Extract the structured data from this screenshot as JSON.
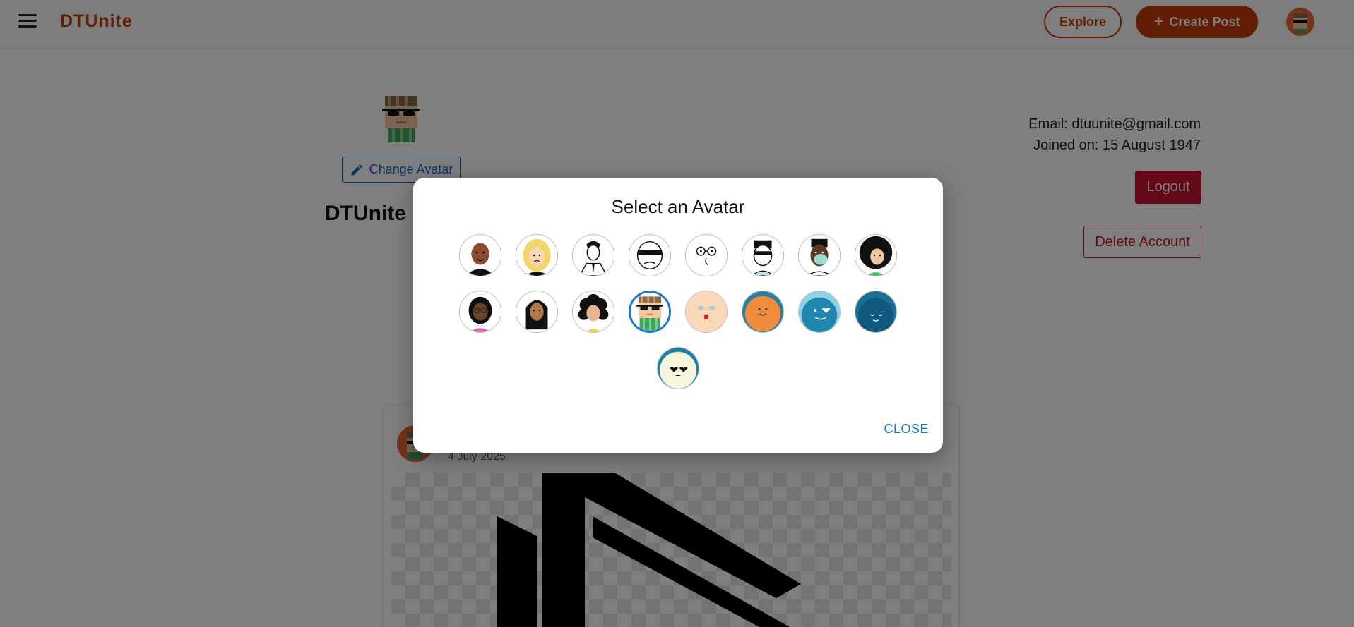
{
  "header": {
    "brand": "DTUnite",
    "explore_label": "Explore",
    "create_post_label": "Create Post",
    "menu_icon": "hamburger-menu-icon",
    "create_icon": "plus-icon"
  },
  "profile": {
    "change_avatar_label": "Change Avatar",
    "change_avatar_icon": "pencil-icon",
    "username": "DTUnite",
    "email_text": "Email: dtuunite@gmail.com",
    "joined_text": "Joined on: 15 August 1947",
    "logout_label": "Logout",
    "delete_label": "Delete Account"
  },
  "post": {
    "date": "4 July 2025"
  },
  "modal": {
    "title": "Select an Avatar",
    "close_label": "CLOSE",
    "selected_index": 11,
    "avatars": [
      "bald-man-avatar",
      "blonde-woman-avatar",
      "man-in-suit-avatar",
      "sunglasses-face-avatar",
      "glasses-face-avatar",
      "sunglasses-man-avatar",
      "masked-man-avatar",
      "afro-woman-avatar",
      "woman-glasses-avatar",
      "long-hair-woman-avatar",
      "curly-hair-woman-avatar",
      "pixel-sunglasses-avatar",
      "peach-face-avatar",
      "orange-smile-avatar",
      "blue-heart-eyes-avatar",
      "dark-blue-sleepy-avatar",
      "cream-heart-eyes-avatar"
    ]
  },
  "colors": {
    "brand": "#c53b0a",
    "logout": "#c8102e",
    "link_blue": "#1565c0",
    "selected_ring": "#1976d2"
  }
}
